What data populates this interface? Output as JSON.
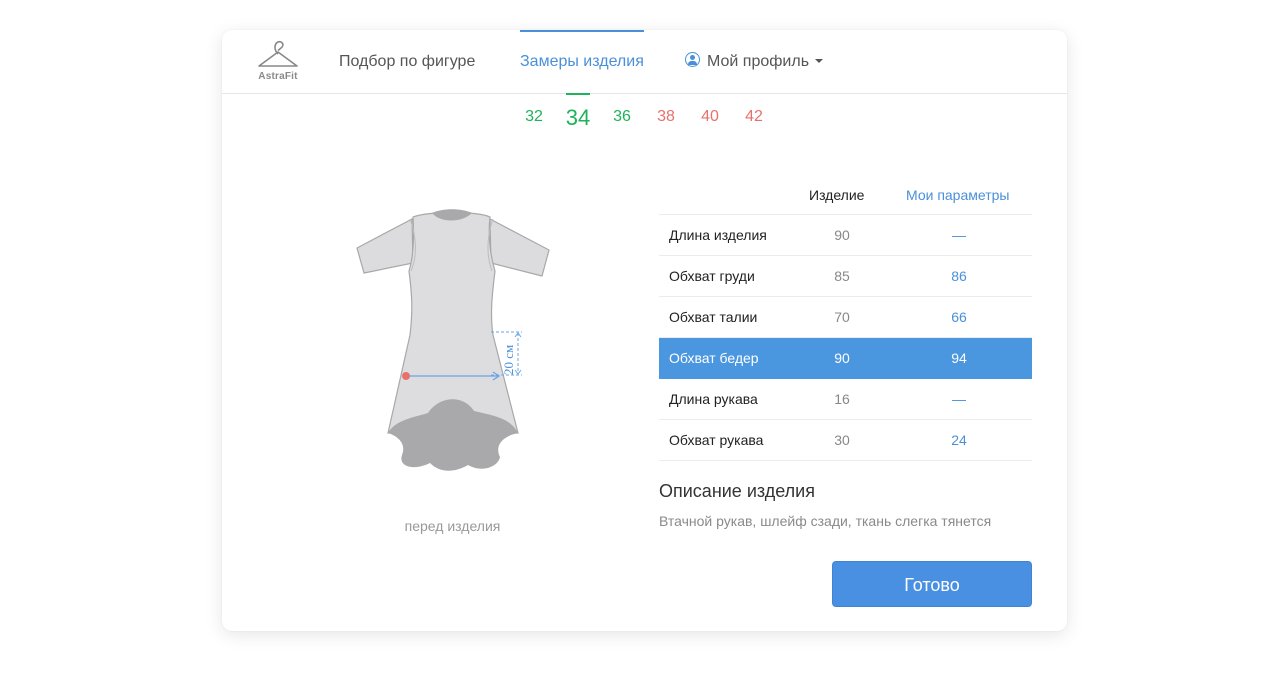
{
  "brand": {
    "logo_text": "AstraFit"
  },
  "nav": {
    "fit_label": "Подбор по фигуре",
    "measurements_label": "Замеры изделия",
    "profile_label": "Мой профиль"
  },
  "sizes": [
    {
      "label": "32",
      "status": "fits"
    },
    {
      "label": "34",
      "status": "fits",
      "selected": true
    },
    {
      "label": "36",
      "status": "fits"
    },
    {
      "label": "38",
      "status": "no-fit"
    },
    {
      "label": "40",
      "status": "no-fit"
    },
    {
      "label": "42",
      "status": "no-fit"
    }
  ],
  "figure": {
    "caption": "перед изделия",
    "measure_label": "20 см"
  },
  "table": {
    "col_item": "Изделие",
    "col_mine": "Мои параметры",
    "rows": [
      {
        "name": "Длина изделия",
        "item": "90",
        "mine": "—"
      },
      {
        "name": "Обхват груди",
        "item": "85",
        "mine": "86"
      },
      {
        "name": "Обхват талии",
        "item": "70",
        "mine": "66"
      },
      {
        "name": "Обхват бедер",
        "item": "90",
        "mine": "94",
        "highlighted": true
      },
      {
        "name": "Длина рукава",
        "item": "16",
        "mine": "—"
      },
      {
        "name": "Обхват рукава",
        "item": "30",
        "mine": "24"
      }
    ]
  },
  "description": {
    "title": "Описание изделия",
    "text": "Втачной рукав, шлейф сзади, ткань слегка тянется"
  },
  "done_button": "Готово",
  "colors": {
    "accent": "#4a90e2",
    "fits": "#1fb25a",
    "no_fit": "#e8716d",
    "highlight_row": "#4a97e0"
  }
}
